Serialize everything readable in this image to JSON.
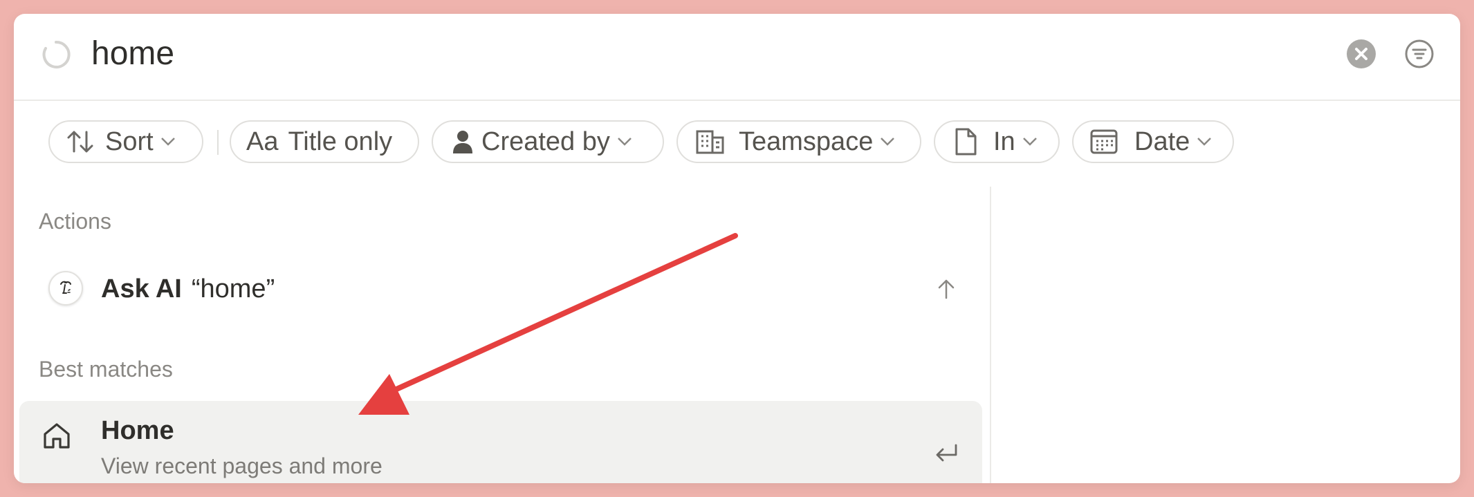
{
  "search": {
    "query": "home"
  },
  "filters": [
    {
      "label": "Sort",
      "icon": "sort-arrows-icon"
    },
    {
      "label": "Title only",
      "prefix": "Aa",
      "icon": "text-aa-icon"
    },
    {
      "label": "Created by",
      "icon": "person-icon"
    },
    {
      "label": "Teamspace",
      "icon": "building-icon"
    },
    {
      "label": "In",
      "icon": "document-icon"
    },
    {
      "label": "Date",
      "icon": "calendar-icon"
    }
  ],
  "actions": {
    "section_label": "Actions",
    "ask_ai": {
      "label": "Ask AI",
      "query": "“home”",
      "icon": "ai-face-icon",
      "shortcut_icon": "arrow-up-icon"
    }
  },
  "best_matches": {
    "section_label": "Best matches",
    "items": [
      {
        "title": "Home",
        "subtitle": "View recent pages and more",
        "icon": "home-icon",
        "shortcut_icon": "enter-icon"
      }
    ]
  },
  "colors": {
    "background": "#efb3ad",
    "annotation_arrow": "#e5403f",
    "selected_row": "#f1f1ef"
  }
}
